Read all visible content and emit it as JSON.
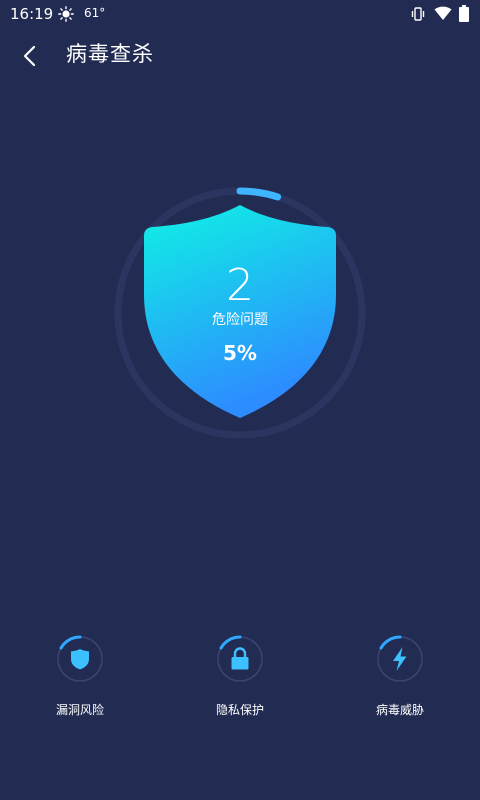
{
  "status_bar": {
    "time": "16:19",
    "temperature": "61°",
    "weather_icon": "sun-icon",
    "icons": [
      "vibrate-icon",
      "wifi-icon",
      "battery-icon"
    ]
  },
  "header": {
    "back_icon": "chevron-left-icon",
    "title": "病毒查杀"
  },
  "scan": {
    "count": "2",
    "label": "危险问题",
    "percent": "5%",
    "progress_fraction": 0.05
  },
  "features": [
    {
      "label": "漏洞风险",
      "icon": "shield-icon"
    },
    {
      "label": "隐私保护",
      "icon": "lock-icon"
    },
    {
      "label": "病毒威胁",
      "icon": "lightning-icon"
    }
  ],
  "colors": {
    "background": "#222c52",
    "accent_cyan": "#0ff2e4",
    "accent_blue": "#2d9bff",
    "ring_dim": "#2b3660"
  }
}
